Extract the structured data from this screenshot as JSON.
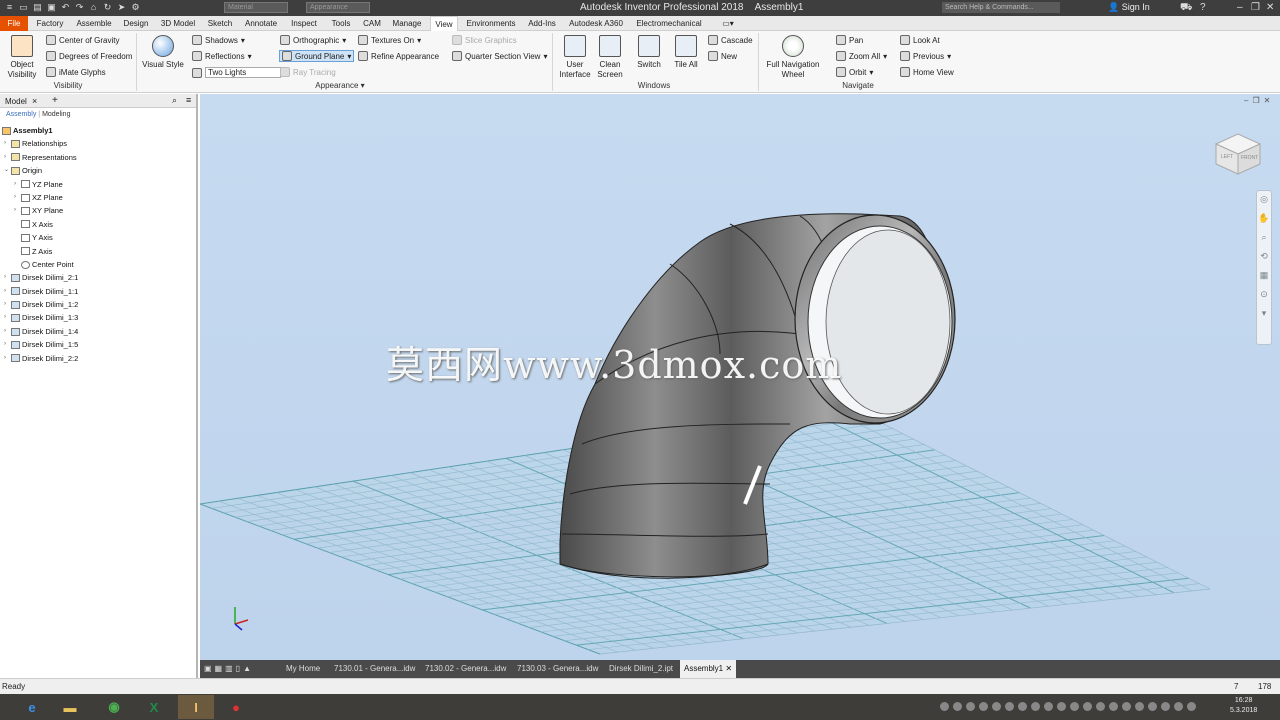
{
  "window": {
    "app_title": "Autodesk Inventor Professional 2018",
    "doc_title": "Assembly1",
    "material_placeholder": "Material",
    "appearance_placeholder": "Appearance",
    "search_placeholder": "Search Help & Commands...",
    "sign_in": "Sign In"
  },
  "tabs": [
    {
      "label": "File"
    },
    {
      "label": "Factory"
    },
    {
      "label": "Assemble"
    },
    {
      "label": "Design"
    },
    {
      "label": "3D Model"
    },
    {
      "label": "Sketch"
    },
    {
      "label": "Annotate"
    },
    {
      "label": "Inspect"
    },
    {
      "label": "Tools"
    },
    {
      "label": "CAM"
    },
    {
      "label": "Manage"
    },
    {
      "label": "View"
    },
    {
      "label": "Environments"
    },
    {
      "label": "Add-Ins"
    },
    {
      "label": "Autodesk A360"
    },
    {
      "label": "Electromechanical"
    }
  ],
  "ribbon": {
    "visibility": {
      "object_visibility": "Object Visibility",
      "center_of_gravity": "Center of Gravity",
      "degrees_of_freedom": "Degrees of Freedom",
      "imate_glyphs": "iMate Glyphs",
      "group_label": "Visibility"
    },
    "appearance": {
      "visual_style": "Visual Style",
      "shadows": "Shadows",
      "reflections": "Reflections",
      "lighting": "Two Lights",
      "orthographic": "Orthographic",
      "ground_plane": "Ground Plane",
      "ray_tracing": "Ray Tracing",
      "textures_on": "Textures On",
      "refine_appearance": "Refine Appearance",
      "slice_graphics": "Slice Graphics",
      "quarter_section_view": "Quarter Section View",
      "group_label": "Appearance"
    },
    "windows": {
      "user_interface": "User Interface",
      "clean_screen": "Clean Screen",
      "switch": "Switch",
      "tile_all": "Tile All",
      "cascade": "Cascade",
      "new": "New",
      "group_label": "Windows"
    },
    "navigate": {
      "full_navigation_wheel": "Full Navigation Wheel",
      "pan": "Pan",
      "zoom_all": "Zoom All",
      "orbit": "Orbit",
      "look_at": "Look At",
      "previous": "Previous",
      "home_view": "Home View",
      "group_label": "Navigate"
    }
  },
  "browser": {
    "tab_label": "Model",
    "sub_assembly": "Assembly",
    "sub_modeling": "Modeling",
    "items": [
      {
        "label": "Assembly1"
      },
      {
        "label": "Relationships"
      },
      {
        "label": "Representations"
      },
      {
        "label": "Origin"
      },
      {
        "label": "YZ Plane"
      },
      {
        "label": "XZ Plane"
      },
      {
        "label": "XY Plane"
      },
      {
        "label": "X Axis"
      },
      {
        "label": "Y Axis"
      },
      {
        "label": "Z Axis"
      },
      {
        "label": "Center Point"
      },
      {
        "label": "Dirsek Dilimi_2:1"
      },
      {
        "label": "Dirsek Dilimi_1:1"
      },
      {
        "label": "Dirsek Dilimi_1:2"
      },
      {
        "label": "Dirsek Dilimi_1:3"
      },
      {
        "label": "Dirsek Dilimi_1:4"
      },
      {
        "label": "Dirsek Dilimi_1:5"
      },
      {
        "label": "Dirsek Dilimi_2:2"
      }
    ]
  },
  "viewport": {
    "watermark": "莫西网www.3dmox.com",
    "viewcube_left": "LEFT",
    "viewcube_front": "FRONT"
  },
  "doc_tabs": [
    {
      "label": "My Home"
    },
    {
      "label": "7130.01 - Genera...idw"
    },
    {
      "label": "7130.02 - Genera...idw"
    },
    {
      "label": "7130.03 - Genera...idw"
    },
    {
      "label": "Dirsek Dilimi_2.ipt"
    },
    {
      "label": "Assembly1"
    }
  ],
  "status": {
    "text": "Ready",
    "count_a": "7",
    "count_b": "178"
  },
  "taskbar": {
    "time": "16:28",
    "date": "5.3.2018"
  },
  "colors": {
    "file_tab": "#e65100",
    "title_bar": "#3e3e3e",
    "viewport_bg": "#c6daf0",
    "grid_line": "#8fb3cc",
    "taskbar": "#3f3d3a"
  }
}
